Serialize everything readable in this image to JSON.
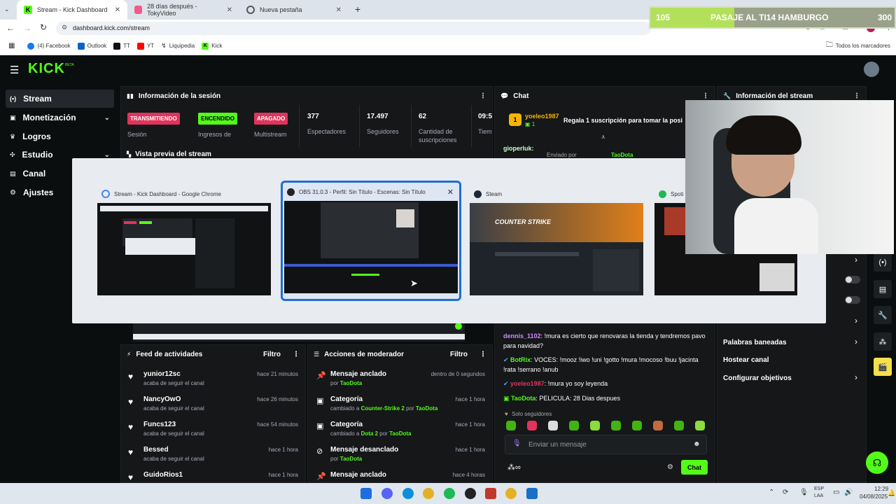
{
  "browser": {
    "tabs": [
      {
        "label": "Stream - Kick Dashboard"
      },
      {
        "label": "28 días después - TokyVideo"
      },
      {
        "label": "Nueva pestaña"
      }
    ],
    "url": "dashboard.kick.com/stream",
    "bookmarks": [
      "(4) Facebook",
      "Outlook",
      "TT",
      "YT",
      "Liquipedia",
      "Kick"
    ],
    "all_bookmarks": "Todos los marcadores"
  },
  "score": {
    "left": "105",
    "text": "PASAJE AL TI14 HAMBURGO",
    "right": "300"
  },
  "kick": {
    "logo": "KICK",
    "beta": "BETA"
  },
  "sidebar": {
    "items": [
      {
        "label": "Stream"
      },
      {
        "label": "Monetización"
      },
      {
        "label": "Logros"
      },
      {
        "label": "Estudio"
      },
      {
        "label": "Canal"
      },
      {
        "label": "Ajustes"
      }
    ]
  },
  "session": {
    "title": "Información de la sesión",
    "badges": {
      "live": "TRANSMITIENDO",
      "on": "ENCENDIDO",
      "off": "APAGADO"
    },
    "labels": {
      "session": "Sesión",
      "ingresos": "Ingresos de",
      "multistream": "Multistream",
      "cantidad": "Cantidad de",
      "suscripciones": "suscripciones"
    },
    "stats": [
      {
        "value": "377",
        "label": "Espectadores"
      },
      {
        "value": "17.497",
        "label": "Seguidores"
      },
      {
        "value": "62",
        "label": ""
      },
      {
        "value": "09:5",
        "label": "Tiem"
      }
    ],
    "preview": "Vista previa del stream"
  },
  "chat": {
    "title": "Chat",
    "sub_user": "yoeleo1987",
    "sub_badge": "1",
    "sub_text": "Regala 1 suscripción para tomar la posi",
    "gioperluk": "gioperluk:",
    "sent_by": "Enviado por",
    "sent_user": "TaoDota",
    "messages": [
      {
        "user": "dennis_1102",
        "text": "!mura es cierto que renovaras la tienda y tendremos pavo para navidad?"
      },
      {
        "user": "BotRix",
        "text": "VOCES: !mooz !iwo !uni !gotto !mura !mocoso !buu !jacinta !rata !serrano !anub"
      },
      {
        "user": "yoeleo1987",
        "text": "!mura yo soy leyenda"
      },
      {
        "user": "TaoDota",
        "text": "PELICULA: 28 Dias despues"
      }
    ],
    "followers_only": "Solo seguidores",
    "placeholder": "Enviar un mensaje",
    "button": "Chat"
  },
  "stream_info": {
    "title": "Información del stream",
    "menu": [
      "Palabras baneadas",
      "Hostear canal",
      "Configurar objetivos"
    ]
  },
  "feed": {
    "title": "Feed de actividades",
    "filter": "Filtro",
    "action": "acaba de seguir el canal",
    "items": [
      {
        "user": "yunior12sc",
        "time": "hace 21 minutos"
      },
      {
        "user": "NancyOwO",
        "time": "hace 26 minutos"
      },
      {
        "user": "Funcs123",
        "time": "hace 54 minutos"
      },
      {
        "user": "Bessed",
        "time": "hace 1 hora"
      },
      {
        "user": "GuidoRios1",
        "time": "hace 1 hora"
      }
    ]
  },
  "mod": {
    "title": "Acciones de moderador",
    "filter": "Filtro",
    "items": [
      {
        "action": "Mensaje anclado",
        "detail_prefix": "por",
        "detail_name": "TaoDota",
        "detail_mid": "",
        "detail_by": "",
        "time": "dentro de 0 segundos"
      },
      {
        "action": "Categoría",
        "detail_prefix": "cambiado a",
        "detail_name": "Counter-Strike 2",
        "detail_mid": "por",
        "detail_by": "TaoDota",
        "time": "hace 1 hora"
      },
      {
        "action": "Categoría",
        "detail_prefix": "cambiado a",
        "detail_name": "Dota 2",
        "detail_mid": "por",
        "detail_by": "TaoDota",
        "time": "hace 1 hora"
      },
      {
        "action": "Mensaje desanclado",
        "detail_prefix": "por",
        "detail_name": "TaoDota",
        "detail_mid": "",
        "detail_by": "",
        "time": "hace 1 hora"
      },
      {
        "action": "Mensaje anclado",
        "detail_prefix": "",
        "detail_name": "",
        "detail_mid": "",
        "detail_by": "",
        "time": "hace 4 horas"
      }
    ]
  },
  "switcher": {
    "windows": [
      {
        "title": "Stream - Kick Dashboard - Google Chrome"
      },
      {
        "title": "OBS 31.0.3 - Perfil: Sin Título - Escenas: Sin Título"
      },
      {
        "title": "Steam"
      },
      {
        "title": "Spoti"
      }
    ],
    "cs_text": "COUNTER STRIKE"
  },
  "taskbar": {
    "lang1": "ESP",
    "lang2": "LAA",
    "time": "12:29",
    "date": "04/08/2025"
  },
  "colors": {
    "accent": "#53fc18",
    "live": "#e1345c",
    "panel": "#151719",
    "bg": "#0b0e0f"
  }
}
